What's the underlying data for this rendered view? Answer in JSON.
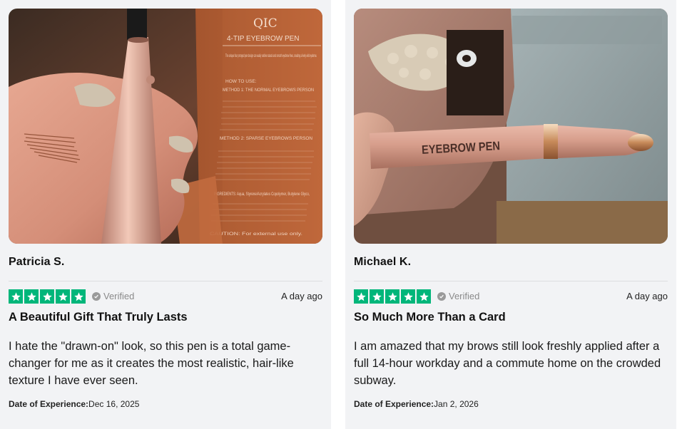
{
  "reviews": [
    {
      "photo_description_icon": "product-photo",
      "reviewer": "Patricia S.",
      "rating": 5,
      "verified_label": "Verified",
      "date_ago": "A day ago",
      "title": "A Beautiful Gift That Truly Lasts",
      "body": "I hate the \"drawn-on\" look, so this pen is a total game-changer for me as it creates the most realistic, hair-like texture I have ever seen.",
      "experience_label": "Date of Experience:",
      "experience_date": "Dec 16, 2025",
      "box_text": {
        "brand": "QIC",
        "product": "4-TIP EYEBROW PEN",
        "intro": "The unique four pronged pen design can easily outline natural and smooth eyebrow lines, creating a lively wild eyebrow.",
        "howto": "HOW TO USE:",
        "method1": "METHOD 1: THE NORMAL EYEBROWS PERSON",
        "method2": "METHOD 2: SPARSE EYEBROWS PERSON",
        "ingredients": "INGREDIENTS: Aqua, Styrene/Acrylates Copolymer, Butylene Glyco,",
        "caution": "CAUTION: For external use only."
      }
    },
    {
      "photo_description_icon": "product-photo",
      "reviewer": "Michael K.",
      "rating": 5,
      "verified_label": "Verified",
      "date_ago": "A day ago",
      "title": "So Much More Than a Card",
      "body": "I am amazed that my brows still look freshly applied after a full 14-hour workday and a commute home on the crowded subway.",
      "experience_label": "Date of Experience:",
      "experience_date": "Jan 2, 2026",
      "pen_text": "EYEBROW PEN"
    }
  ],
  "colors": {
    "star_green": "#00b67a",
    "card_bg": "#f2f3f5",
    "rose_gold": "#c99585"
  }
}
